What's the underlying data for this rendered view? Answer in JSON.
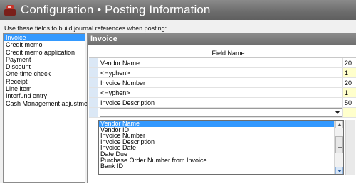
{
  "window": {
    "title": "Configuration • Posting Information"
  },
  "instruction": "Use these fields to build journal references when posting:",
  "transaction_types": {
    "selected_index": 0,
    "items": [
      "Invoice",
      "Credit memo",
      "Credit memo application",
      "Payment",
      "Discount",
      "One-time check",
      "Receipt",
      "Line item",
      "Interfund entry",
      "Cash Management adjustment"
    ]
  },
  "panel": {
    "title": "Invoice",
    "column_header": "Field Name",
    "rows": [
      {
        "name": "Vendor Name",
        "length": "20",
        "yellow": false
      },
      {
        "name": "<Hyphen>",
        "length": "1",
        "yellow": true
      },
      {
        "name": "Invoice Number",
        "length": "20",
        "yellow": false
      },
      {
        "name": "<Hyphen>",
        "length": "1",
        "yellow": true
      },
      {
        "name": "Invoice Description",
        "length": "50",
        "yellow": false
      }
    ],
    "edit_row": {
      "value": "",
      "length": ""
    }
  },
  "dropdown": {
    "selected_index": 0,
    "options": [
      "Vendor Name",
      "Vendor ID",
      "Invoice Number",
      "Invoice Description",
      "Invoice Date",
      "Date Due",
      "Purchase Order Number from Invoice",
      "Bank ID"
    ]
  },
  "icons": {
    "app": "posting-app-icon",
    "dropdown_arrow": "chevron-down-icon",
    "scroll_up": "scroll-up-icon",
    "scroll_down": "scroll-down-icon"
  }
}
